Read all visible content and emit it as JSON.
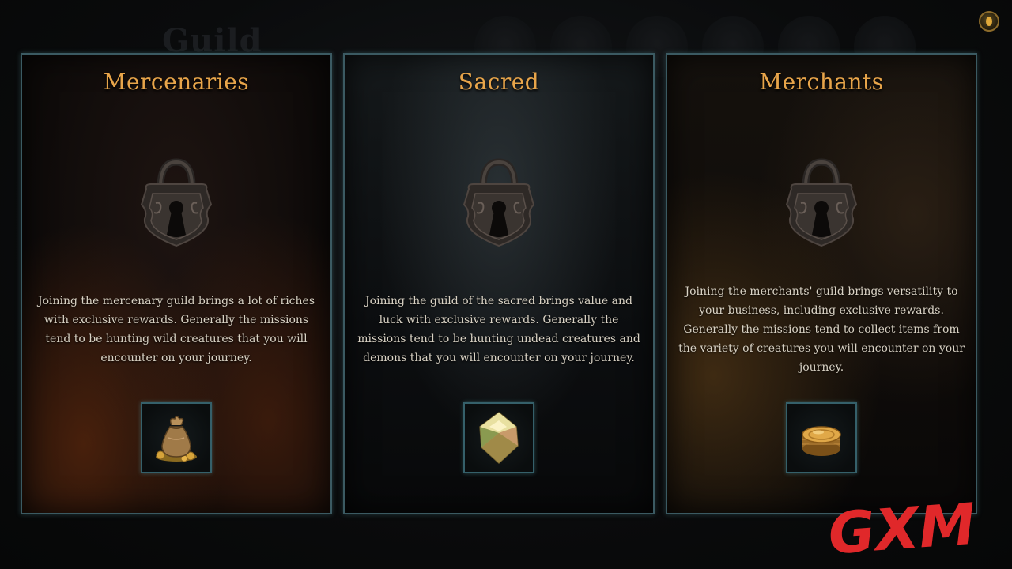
{
  "background": {
    "title": "Guild"
  },
  "colors": {
    "title": "#e8a54a",
    "border": "#3b5a62",
    "text": "#d9d2c4"
  },
  "header": {
    "coin_icon": "gold-coin-icon"
  },
  "cards": [
    {
      "title": "Mercenaries",
      "description": "Joining the mercenary guild brings a lot of riches with exclusive rewards. Generally the missions tend to be hunting wild creatures that you will encounter on your journey.",
      "lock_icon": "padlock-icon",
      "reward_icon": "gold-sack-icon"
    },
    {
      "title": "Sacred",
      "description": "Joining the guild of the sacred brings value and luck with exclusive rewards. Generally the missions tend to be hunting undead creatures and demons that you will encounter on your journey.",
      "lock_icon": "padlock-icon",
      "reward_icon": "crystal-gem-icon"
    },
    {
      "title": "Merchants",
      "description": "Joining the merchants' guild brings versatility to your business, including exclusive rewards. Generally the missions tend to collect items from the variety of creatures you will encounter on your journey.",
      "lock_icon": "padlock-icon",
      "reward_icon": "coin-stack-icon"
    }
  ],
  "watermark": {
    "text": "GXM"
  }
}
